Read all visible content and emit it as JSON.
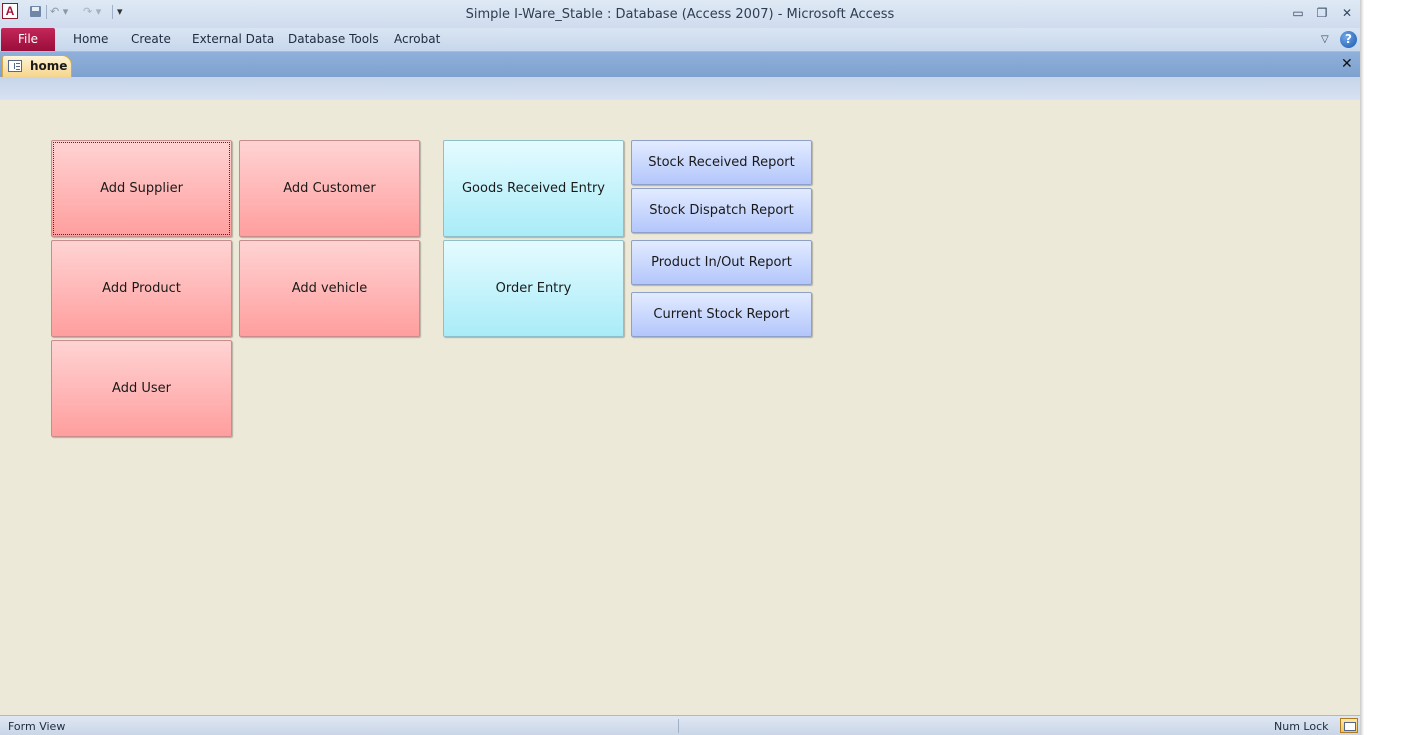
{
  "window": {
    "title": "Simple I-Ware_Stable : Database (Access 2007)  -  Microsoft Access",
    "app_icon_letter": "A",
    "minimize": "▭",
    "restore": "❐",
    "close": "✕"
  },
  "quick_access": {
    "undo": "↶ ▾",
    "redo": "↷ ▾",
    "customize": "▾"
  },
  "ribbon": {
    "tabs": {
      "file": "File",
      "home": "Home",
      "create": "Create",
      "external_data": "External Data",
      "database_tools": "Database Tools",
      "acrobat": "Acrobat"
    },
    "minimize_glyph": "▽",
    "help_glyph": "?"
  },
  "document": {
    "tab_label": "home",
    "close_glyph": "✕"
  },
  "form": {
    "buttons": {
      "add_supplier": "Add Supplier",
      "add_customer": "Add Customer",
      "add_product": "Add Product",
      "add_vehicle": "Add vehicle",
      "add_user": "Add User",
      "goods_received_entry": "Goods Received Entry",
      "order_entry": "Order Entry",
      "stock_received_report": "Stock Received Report",
      "stock_dispatch_report": "Stock Dispatch Report",
      "product_in_out_report": "Product In/Out Report",
      "current_stock_report": "Current Stock Report"
    }
  },
  "status": {
    "left": "Form View",
    "num_lock": "Num Lock"
  },
  "colors": {
    "file_tab": "#b0184a",
    "form_background": "#ede9d8",
    "red_button": "#ffb3b3",
    "cyan_button": "#c5f3fb",
    "blue_button": "#c8d6fd"
  }
}
